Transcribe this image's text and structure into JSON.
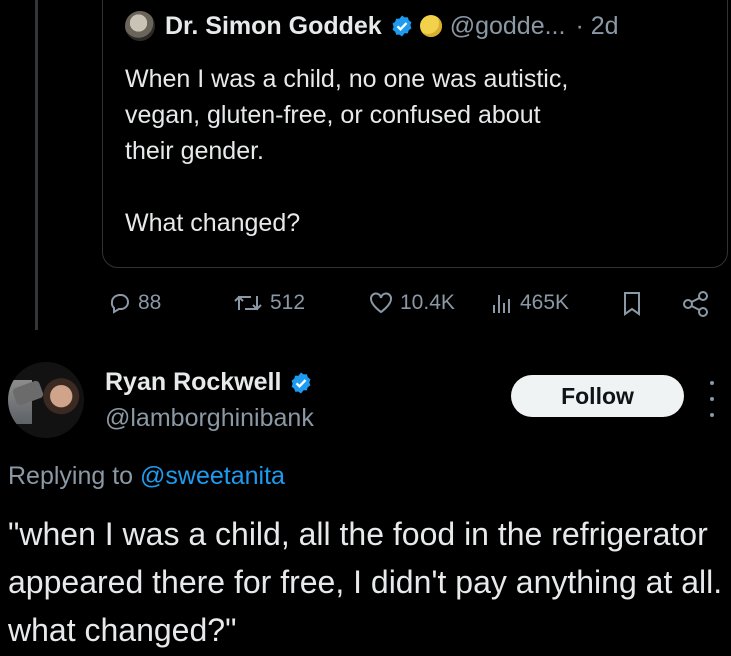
{
  "quoted_post": {
    "author_name": "Dr. Simon Goddek",
    "handle": "@godde...",
    "time": "· 2d",
    "text": "When I was a child, no one was autistic,\nvegan, gluten-free, or confused about\ntheir gender.\n\nWhat changed?"
  },
  "actions": {
    "replies": "88",
    "reposts": "512",
    "likes": "10.4K",
    "views": "465K"
  },
  "reply_post": {
    "author_name": "Ryan Rockwell",
    "handle": "@lamborghinibank",
    "follow_label": "Follow",
    "replying_prefix": "Replying to",
    "replying_handle": "@sweetanita",
    "text": "\"when I was a child, all the food in the refrigerator appeared there for free, I didn't pay anything at all. what changed?\""
  },
  "colors": {
    "background": "#000000",
    "text": "#e7e9ea",
    "muted": "#8b98a5",
    "link": "#1d9bf0",
    "verified": "#1d9bf0"
  },
  "icons": [
    "verified-badge-icon",
    "gold-badge-icon",
    "reply-icon",
    "repost-icon",
    "like-icon",
    "views-icon",
    "bookmark-icon",
    "share-icon",
    "more-options-icon"
  ]
}
